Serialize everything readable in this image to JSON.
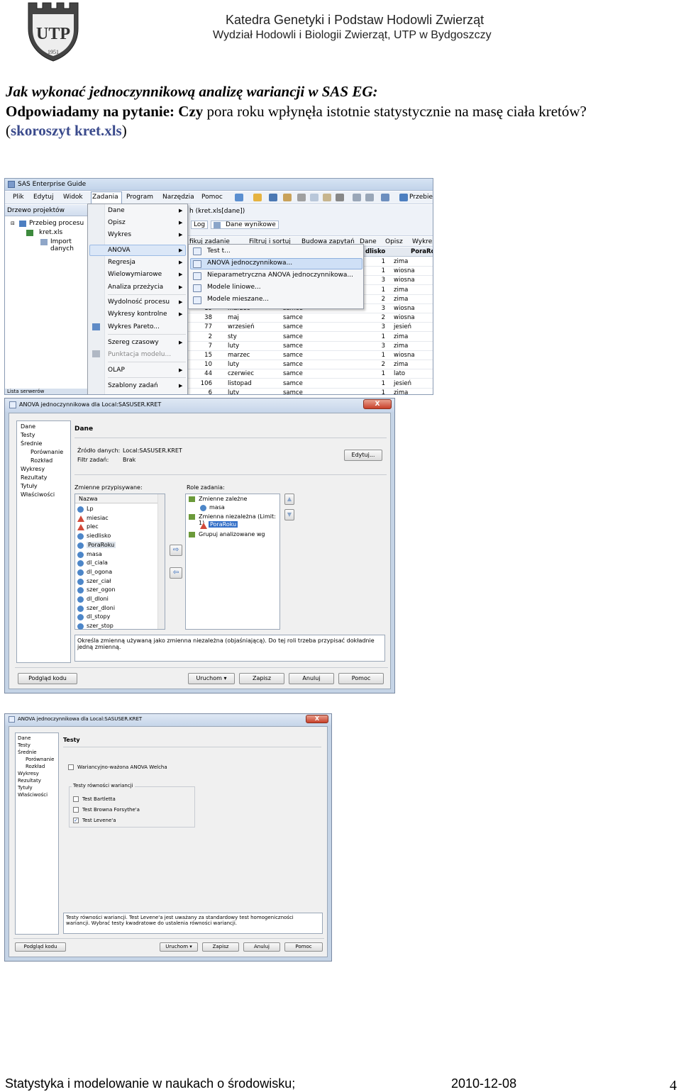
{
  "header": {
    "line1": "Katedra Genetyki i Podstaw Hodowli Zwierząt",
    "line2": "Wydział Hodowli i Biologii Zwierząt, UTP w Bydgoszczy",
    "logo_text": "UTP",
    "logo_year": "1951"
  },
  "title": "Jak wykonać jednoczynnikową analizę wariancji w SAS EG:",
  "question": {
    "lead": "Odpowiadamy na pytanie: Czy",
    "rest": " pora roku wpłynęła istotnie statystycznie na masę ciała kretów?"
  },
  "file": {
    "open": "(",
    "name": "skoroszyt kret.xls",
    "close": ")"
  },
  "eg": {
    "window_title": "SAS Enterprise Guide",
    "menu": [
      "Plik",
      "Edytuj",
      "Widok",
      "Zadania",
      "Program",
      "Narzędzia",
      "Pomoc"
    ],
    "toolbar_right": "Przebieg",
    "left_pane_title": "Drzewo projektów",
    "tree": [
      "Przebieg procesu",
      "kret.xls",
      "Import danych"
    ],
    "lista": "Lista serwerów",
    "tab_title": "h (kret.xls[dane])",
    "subtabs": [
      "Log",
      "Dane wynikowe"
    ],
    "grid_toolbar": [
      "fikuj zadanie",
      "Filtruj i sortuj",
      "Budowa zapytań",
      "Dane",
      "Opisz",
      "Wykres"
    ],
    "col_headers": [
      "dlisko",
      "PoraRok"
    ],
    "zadania_menu": [
      "Dane",
      "Opisz",
      "Wykres",
      "ANOVA",
      "Regresja",
      "Wielowymiarowe",
      "Analiza przeżycia",
      "Wydolność procesu",
      "Wykresy kontrolne",
      "Wykres Pareto...",
      "Szereg czasowy",
      "Punktacja modelu...",
      "OLAP",
      "Szablony zadań"
    ],
    "anova_menu": [
      "Test t...",
      "ANOVA jednoczynnikowa...",
      "Nieparametryczna ANOVA jednoczynnikowa...",
      "Modele liniowe...",
      "Modele mieszane..."
    ],
    "rows": [
      {
        "a": "",
        "m": "",
        "s": "",
        "n": "1",
        "p": "zima"
      },
      {
        "a": "",
        "m": "",
        "s": "",
        "n": "1",
        "p": "wiosna"
      },
      {
        "a": "",
        "m": "",
        "s": "",
        "n": "3",
        "p": "wiosna"
      },
      {
        "a": "",
        "m": "",
        "s": "",
        "n": "1",
        "p": "zima"
      },
      {
        "a": "",
        "m": "",
        "s": "",
        "n": "2",
        "p": "zima"
      },
      {
        "a": "19",
        "m": "marzec",
        "s": "samce",
        "n": "3",
        "p": "wiosna"
      },
      {
        "a": "38",
        "m": "maj",
        "s": "samce",
        "n": "2",
        "p": "wiosna"
      },
      {
        "a": "77",
        "m": "wrzesień",
        "s": "samce",
        "n": "3",
        "p": "jesień"
      },
      {
        "a": "2",
        "m": "sty",
        "s": "samce",
        "n": "1",
        "p": "zima"
      },
      {
        "a": "7",
        "m": "luty",
        "s": "samce",
        "n": "3",
        "p": "zima"
      },
      {
        "a": "15",
        "m": "marzec",
        "s": "samce",
        "n": "1",
        "p": "wiosna"
      },
      {
        "a": "10",
        "m": "luty",
        "s": "samce",
        "n": "2",
        "p": "zima"
      },
      {
        "a": "44",
        "m": "czerwiec",
        "s": "samce",
        "n": "1",
        "p": "lato"
      },
      {
        "a": "106",
        "m": "listopad",
        "s": "samce",
        "n": "1",
        "p": "jesień"
      },
      {
        "a": "6",
        "m": "luty",
        "s": "samce",
        "n": "1",
        "p": "zima"
      }
    ]
  },
  "dialog1": {
    "title": "ANOVA jednoczynnikowa dla Local:SASUSER.KRET",
    "close": "X",
    "nav": [
      "Dane",
      "Testy",
      "Średnie",
      "Porównanie",
      "Rozkład",
      "Wykresy",
      "Rezultaty",
      "Tytuły",
      "Właściwości"
    ],
    "section_title": "Dane",
    "source_label": "Źródło danych:",
    "source_value": "Local:SASUSER.KRET",
    "filter_label": "Filtr zadań:",
    "filter_value": "Brak",
    "edit_button": "Edytuj...",
    "vars_label": "Zmienne przypisywane:",
    "roles_label": "Role zadania:",
    "vars_header": "Nazwa",
    "vars": [
      "Lp",
      "miesiac",
      "plec",
      "siedlisko",
      "PoraRoku",
      "masa",
      "dl_ciala",
      "dl_ogona",
      "szer_ciał",
      "szer_ogon",
      "dl_dloni",
      "szer_dloni",
      "dl_stopy",
      "szer_stop"
    ],
    "roles": [
      "Zmienne zależne",
      "masa",
      "Zmienna niezależna  (Limit: 1)",
      "PoraRoku",
      "Grupuj analizowane wg"
    ],
    "hint": "Określa zmienną używaną jako zmienna niezależna (objaśniającą). Do tej roli trzeba przypisać dokładnie jedną zmienną.",
    "buttons": [
      "Podgląd kodu",
      "Uruchom",
      "Zapisz",
      "Anuluj",
      "Pomoc"
    ]
  },
  "dialog2": {
    "title": "ANOVA jednoczynnikowa dla Local:SASUSER.KRET",
    "close": "X",
    "nav": [
      "Dane",
      "Testy",
      "Średnie",
      "Porównanie",
      "Rozkład",
      "Wykresy",
      "Rezultaty",
      "Tytuły",
      "Właściwości"
    ],
    "section_title": "Testy",
    "welch": "Wariancyjno-ważona ANOVA Welcha",
    "group_label": "Testy równości wariancji",
    "tests": [
      "Test Bartletta",
      "Test Browna Forsythe'a",
      "Test Levene'a"
    ],
    "hint": "Testy równości wariancji. Test Levene'a jest uważany za standardowy test homogeniczności wariancji. Wybrać testy kwadratowe do ustalenia równości wariancji.",
    "buttons": [
      "Podgląd kodu",
      "Uruchom",
      "Zapisz",
      "Anuluj",
      "Pomoc"
    ]
  },
  "footer": {
    "left": "Statystyka i modelowanie w naukach o środowisku;",
    "date": "2010-12-08",
    "page": "4"
  },
  "colors": {
    "accent_blue": "#3a4a8c",
    "selection": "#cfe0f6",
    "close_red": "#c8402a"
  }
}
